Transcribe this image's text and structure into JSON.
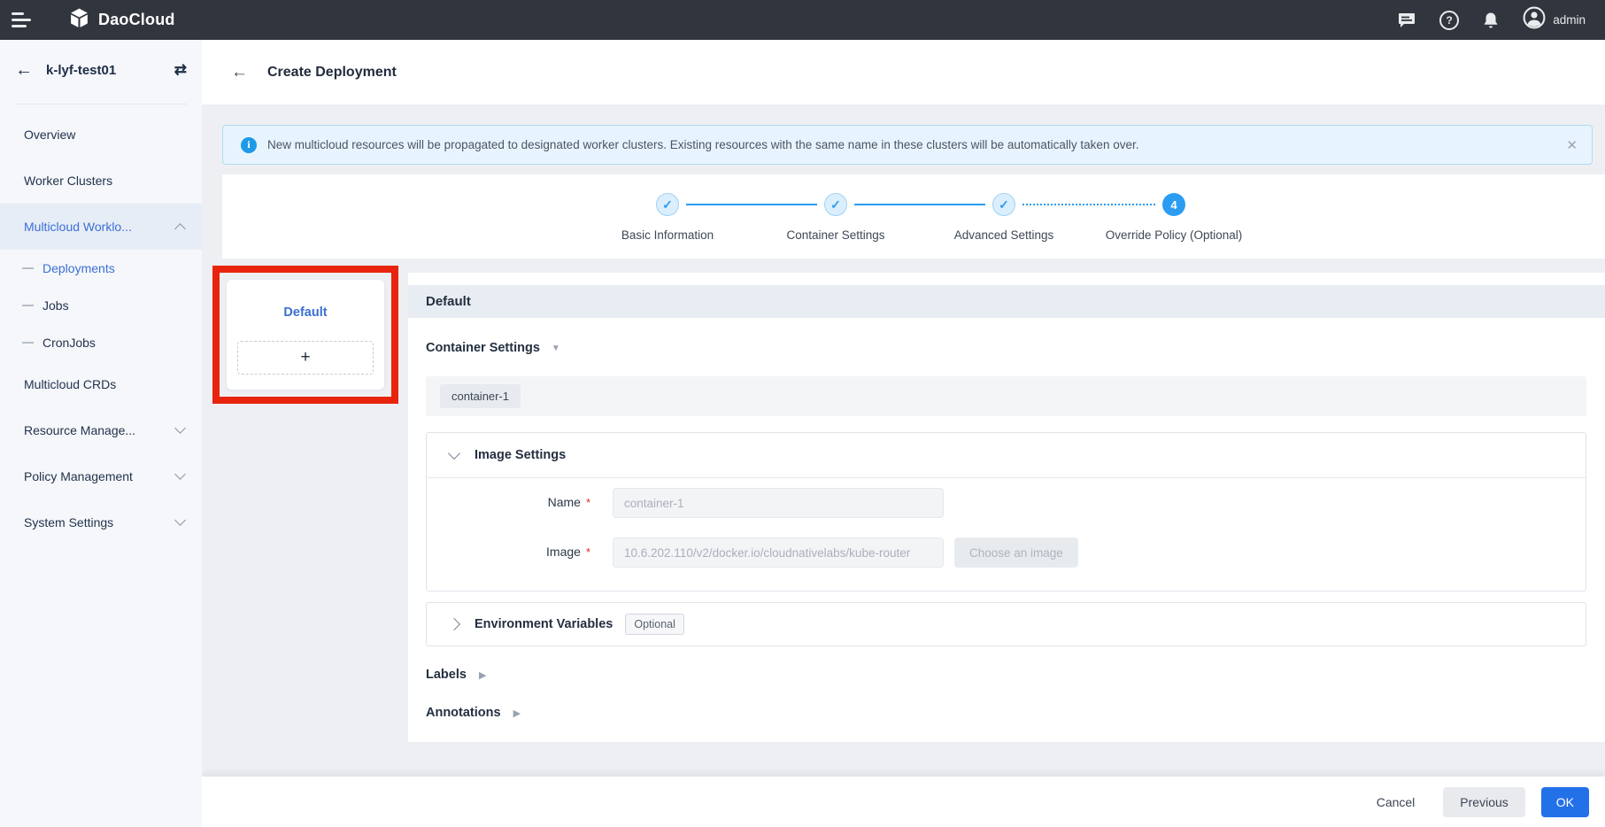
{
  "glyphs": {
    "back_arrow": "←",
    "switch": "⇄",
    "check": "✓",
    "plus": "+",
    "close": "✕",
    "info": "i",
    "question": "?",
    "caret_down": "▼",
    "caret_right": "▶"
  },
  "topbar": {
    "logo_text": "DaoCloud",
    "user": "admin"
  },
  "sidebar": {
    "cluster_name": "k-lyf-test01",
    "items": [
      {
        "label": "Overview"
      },
      {
        "label": "Worker Clusters"
      },
      {
        "label": "Multicloud Worklo...",
        "active": true,
        "expanded": true
      },
      {
        "label": "Deployments",
        "sub": true,
        "active": true
      },
      {
        "label": "Jobs",
        "sub": true
      },
      {
        "label": "CronJobs",
        "sub": true
      },
      {
        "label": "Multicloud CRDs"
      },
      {
        "label": "Resource Manage...",
        "collapsed": true
      },
      {
        "label": "Policy Management",
        "collapsed": true
      },
      {
        "label": "System Settings",
        "collapsed": true
      }
    ]
  },
  "header": {
    "title": "Create Deployment"
  },
  "banner": {
    "text": "New multicloud resources will be propagated to designated worker clusters. Existing resources with the same name in these clusters will be automatically taken over."
  },
  "stepper": {
    "steps": [
      {
        "label": "Basic Information",
        "state": "done"
      },
      {
        "label": "Container Settings",
        "state": "done"
      },
      {
        "label": "Advanced Settings",
        "state": "done"
      },
      {
        "label": "Override Policy (Optional)",
        "state": "current",
        "number": "4"
      }
    ]
  },
  "tab_panel": {
    "tab_label": "Default"
  },
  "form": {
    "section_title": "Default",
    "container_settings_title": "Container Settings",
    "container_tag": "container-1",
    "image_settings": {
      "title": "Image Settings",
      "name_label": "Name",
      "name_placeholder": "container-1",
      "image_label": "Image",
      "image_placeholder": "10.6.202.110/v2/docker.io/cloudnativelabs/kube-router",
      "choose_image_button": "Choose an image",
      "required_marker": "*"
    },
    "environment_variables": {
      "title": "Environment Variables",
      "badge": "Optional"
    },
    "labels_title": "Labels",
    "annotations_title": "Annotations"
  },
  "footer": {
    "cancel": "Cancel",
    "previous": "Previous",
    "ok": "OK"
  },
  "colors": {
    "topbar_bg": "#31353d",
    "sidebar_bg": "#f5f7fa",
    "accent_blue": "#3b6fd4",
    "stepper_blue": "#2b9cf2",
    "ok_button_blue": "#2371e9",
    "annotation_red": "#e8240e",
    "banner_bg": "#e7f4fd"
  }
}
